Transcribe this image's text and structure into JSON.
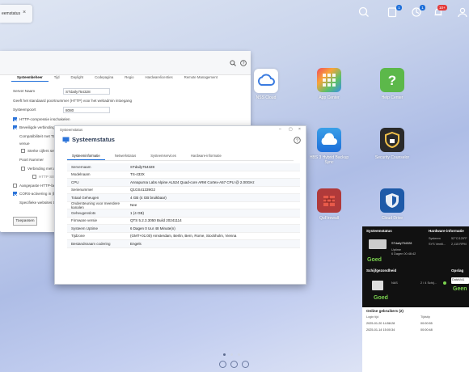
{
  "taskbar": {
    "task_label": "eemstatus",
    "badge_updates": "1",
    "badge_tasks": "1",
    "badge_notifications": "10+"
  },
  "desktop_icons": [
    {
      "label": "NSS Cloud",
      "color": "#3a7be0"
    },
    {
      "label": "App Center",
      "color": "#e84e4e"
    },
    {
      "label": "Help Center",
      "color": "#5cb84a"
    },
    {
      "label": "HBS 3 Hybrid Backup Sync",
      "color": "#3aa0e8"
    },
    {
      "label": "Security Counselor",
      "color": "#2a2a2a"
    },
    {
      "label": "QuFirewall",
      "color": "#b03a3a"
    },
    {
      "label": "Cloud Drive",
      "color": "#1e5aa8"
    }
  ],
  "settings_window": {
    "tabs": [
      "Systeembeheer",
      "Tijd",
      "Daylight",
      "Codepagina",
      "Regio",
      "Hardwarelicenties",
      "Remote Management"
    ],
    "active_tab": "Systeembeheer",
    "server_name_label": "Server Naam",
    "server_name_value": "STdaily754328",
    "port_note": "Geeft het standaard poortnummer (HTTP) voor het webadmin intoegang",
    "port_label": "Systeempoort",
    "port_value": "8080",
    "http_compression": "HTTP-compressie inschakelen",
    "secure_connection": "Beveiligde verbinding (H",
    "compat_text": "Compatibiliteit met TLS",
    "enable_text": "venue",
    "only_secure": "Sterke cijfers selectere",
    "port_number": "Poort Nummer",
    "redirect": "Verbinding met de b",
    "http_strict": "HTTP Strict",
    "custom_https": "Aangepaste HTTP-beve",
    "cors": "CORS-activering in (beveiligde",
    "cors_note": "Specifieke websites toe",
    "apply_label": "Toepassen"
  },
  "status_dialog": {
    "caption": "Systeemstatus",
    "title": "Systeemstatus",
    "tabs": [
      "Systeeminformatie",
      "Netwerkstatus",
      "Systeemservices",
      "Hardware-informatie"
    ],
    "active_tab": "Systeeminformatie",
    "rows": [
      {
        "key": "Servernaam",
        "value": "STdaily754328"
      },
      {
        "key": "Modelnaam",
        "value": "TS-433X"
      },
      {
        "key": "CPU",
        "value": "Annapurna Labs Alpine AL524 Quad-core ARM Cortex-A57 CPU @ 2.00GHz"
      },
      {
        "key": "Serienummer",
        "value": "Q1GS41339G2"
      },
      {
        "key": "Totaal Geheugen",
        "value": "4 GB (4 GB bruikbaar)"
      },
      {
        "key": "Ondersteuning voor meerdere kanalen",
        "value": "Nee"
      },
      {
        "key": "Geheugenslots",
        "value": "1 (4 GB)"
      },
      {
        "key": "Firmware versie",
        "value": "QTS 5.2.3.3050 Build 20241114"
      },
      {
        "key": "Systeem Uptime",
        "value": "6 Dagen 0 Uur 48 Minute(n)"
      },
      {
        "key": "Tijdzone",
        "value": "(GMT+01:00) Amsterdam, Berlin, Bern, Rome, Stockholm, Vienna"
      },
      {
        "key": "Bestandsnaam codering",
        "value": "Engels"
      }
    ]
  },
  "right_panel": {
    "systeemstatus_label": "Systeemstatus",
    "hardware_label": "Hardware-informatie",
    "server_name": "STdaily754328",
    "uptime_label": "Uptime",
    "uptime_value": "6 Dagen 00:48:42",
    "system_label": "Systeem",
    "system_value": "52°C/125°F",
    "fan_label": "SYS Ventil...",
    "fan_value": "2,115 RPM",
    "goed_1": "Goed",
    "schijf_label": "Schijfgezondheid",
    "opslag_label": "Opslag",
    "nas_label": "NAS",
    "disk_count": "2 / 4 Schij...",
    "goed_2": "Goed",
    "goed_3": "Geen",
    "volume_label": "DataVol1",
    "online_label": "Online gebruikers",
    "online_count": "(2)",
    "col_login": "Login tijd",
    "col_time": "Tijdstip",
    "row1_date": "2025-01-20 14:58:28",
    "row1_time": "00:00:55",
    "row2_date": "2025-01-14 15:00:34",
    "row2_time": "00:00:48"
  }
}
